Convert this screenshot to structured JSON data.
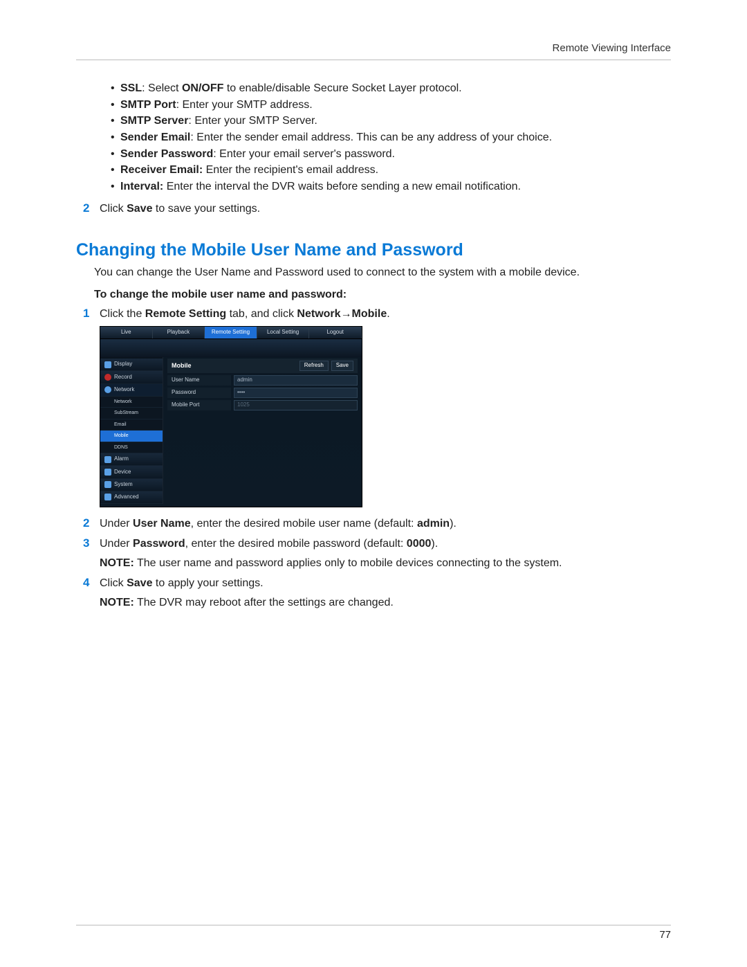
{
  "header": {
    "section": "Remote Viewing Interface"
  },
  "bullets": [
    {
      "term": "SSL",
      "sep": ": Select ",
      "bold2": "ON/OFF",
      "rest": " to enable/disable Secure Socket Layer protocol."
    },
    {
      "term": "SMTP Port",
      "sep": ": Enter your SMTP address.",
      "bold2": "",
      "rest": ""
    },
    {
      "term": "SMTP Server",
      "sep": ": Enter your SMTP Server.",
      "bold2": "",
      "rest": ""
    },
    {
      "term": "Sender Email",
      "sep": ": Enter the sender email address. This can be any address of your choice.",
      "bold2": "",
      "rest": ""
    },
    {
      "term": "Sender Password",
      "sep": ": Enter your email server's password.",
      "bold2": "",
      "rest": ""
    },
    {
      "term": "Receiver Email:",
      "sep": " Enter the recipient's email address.",
      "bold2": "",
      "rest": ""
    },
    {
      "term": "Interval:",
      "sep": " Enter the interval the DVR waits before sending a new email notification.",
      "bold2": "",
      "rest": ""
    }
  ],
  "step2a": {
    "num": "2",
    "pre": "Click ",
    "bold": "Save",
    "post": " to save your settings."
  },
  "section_title": "Changing the Mobile User Name and Password",
  "intro": "You can change the User Name and Password used to connect to the system with a mobile device.",
  "subhead": "To change the mobile user name and password:",
  "step1": {
    "num": "1",
    "pre": "Click the ",
    "b1": "Remote Setting",
    "mid": " tab, and click ",
    "b2": "Network",
    "arrow": "→",
    "b3": "Mobile",
    "post": "."
  },
  "dvr": {
    "tabs": [
      "Live",
      "Playback",
      "Remote Setting",
      "Local Setting",
      "Logout"
    ],
    "sidebar": {
      "display": "Display",
      "record": "Record",
      "network": "Network",
      "subs": [
        "Network",
        "SubStream",
        "Email",
        "Mobile",
        "DDNS"
      ],
      "alarm": "Alarm",
      "device": "Device",
      "system": "System",
      "advanced": "Advanced"
    },
    "panel": {
      "title": "Mobile",
      "refresh": "Refresh",
      "save": "Save",
      "rows": {
        "username_label": "User Name",
        "username_value": "admin",
        "password_label": "Password",
        "password_value": "••••",
        "port_label": "Mobile Port",
        "port_value": "1025"
      }
    }
  },
  "step2b": {
    "num": "2",
    "pre": "Under ",
    "b1": "User Name",
    "mid": ", enter the desired mobile user name (default: ",
    "b2": "admin",
    "post": ")."
  },
  "step3": {
    "num": "3",
    "pre": "Under ",
    "b1": "Password",
    "mid": ", enter the desired mobile password (default: ",
    "b2": "0000",
    "post": ")."
  },
  "note1": {
    "b": "NOTE:",
    "rest": " The user name and password applies only to mobile devices connecting to the system."
  },
  "step4": {
    "num": "4",
    "pre": "Click ",
    "b1": "Save",
    "post": " to apply your settings."
  },
  "note2": {
    "b": "NOTE:",
    "rest": " The DVR may reboot after the settings are changed."
  },
  "page_number": "77"
}
